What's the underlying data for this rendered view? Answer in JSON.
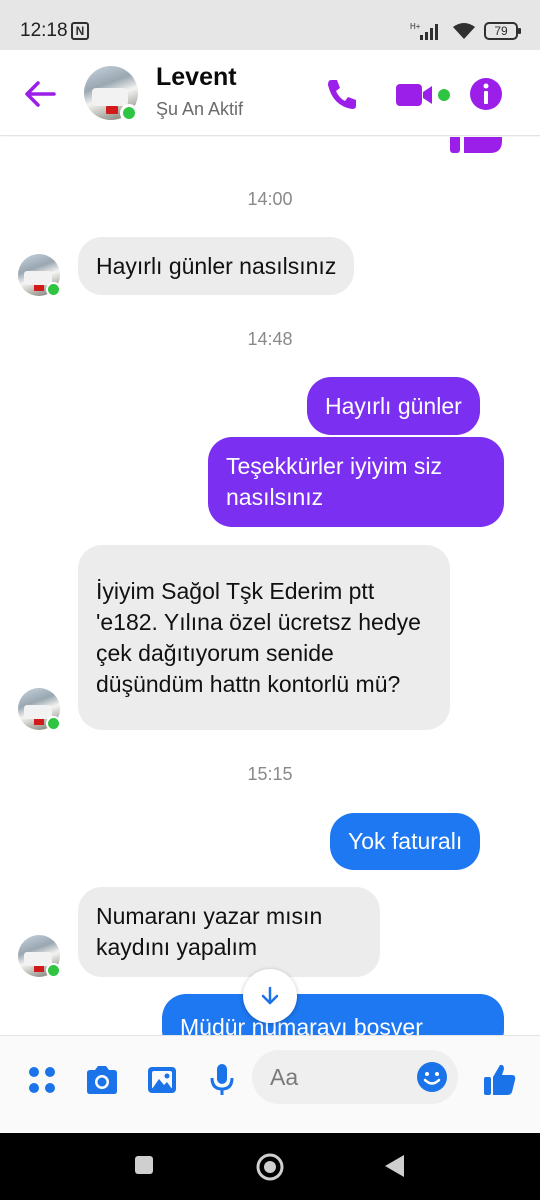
{
  "status_bar": {
    "time": "12:18",
    "n_icon": "N",
    "network": "H+",
    "battery": "79"
  },
  "header": {
    "contact_name": "Levent",
    "status": "Şu An Aktif",
    "accent_color": "#9b1fe8"
  },
  "messages": [
    {
      "type": "timestamp",
      "text": "14:00"
    },
    {
      "type": "incoming",
      "text": "Hayırlı günler nasılsınız"
    },
    {
      "type": "timestamp",
      "text": "14:48"
    },
    {
      "type": "outgoing",
      "text": "Hayırlı günler"
    },
    {
      "type": "outgoing",
      "text": "Teşekkürler iyiyim siz nasılsınız"
    },
    {
      "type": "incoming",
      "text": "İyiyim Sağol Tşk Ederim ptt 'e182. Yılına özel ücretsz hedye çek dağıtıyorum senide düşündüm hattn kontorlü mü?"
    },
    {
      "type": "timestamp",
      "text": "15:15"
    },
    {
      "type": "outgoing",
      "text": "Yok faturalı"
    },
    {
      "type": "incoming",
      "text": "Numaranı yazar mısın kaydını yapalım"
    },
    {
      "type": "outgoing",
      "text": "Müdür numarayı boşver"
    }
  ],
  "composer": {
    "placeholder": "Aa",
    "icons": [
      "menu-dots-icon",
      "camera-icon",
      "gallery-icon",
      "microphone-icon",
      "emoji-icon",
      "thumbs-up-icon"
    ]
  },
  "colors": {
    "outgoing_purple": "#7b2ff0",
    "outgoing_blue": "#1d78f2",
    "incoming_gray": "#ececec",
    "composer_blue": "#1a73e8"
  }
}
